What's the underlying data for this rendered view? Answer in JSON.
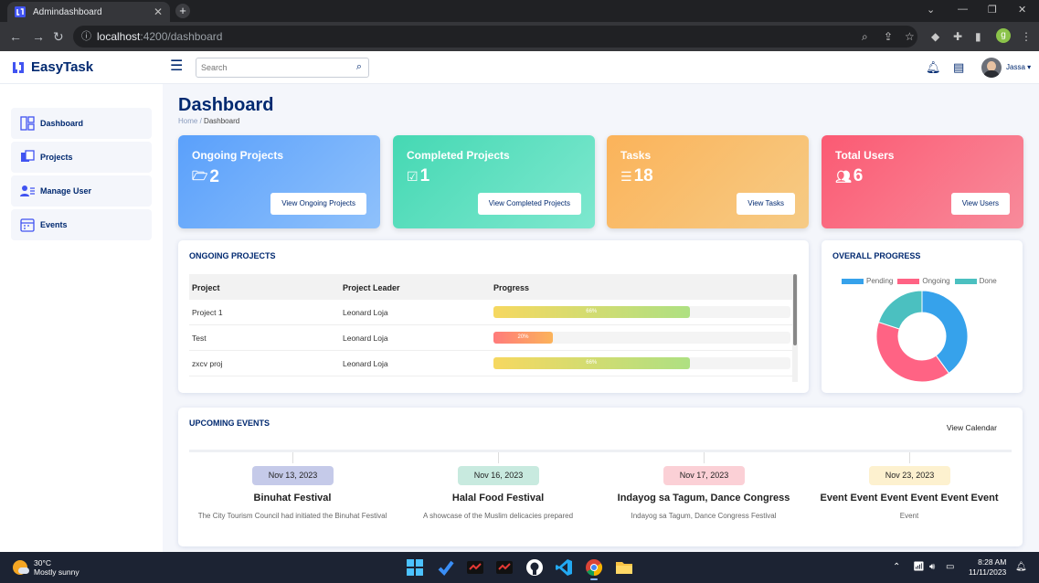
{
  "browser": {
    "tab_title": "Admindashboard",
    "url_host": "localhost",
    "url_path": ":4200/dashboard",
    "profile_initial": "g"
  },
  "header": {
    "logo_text": "EasyTask",
    "search_placeholder": "Search",
    "user_name": "Jassa"
  },
  "sidebar": {
    "items": [
      {
        "label": "Dashboard",
        "icon": "dashboard-icon"
      },
      {
        "label": "Projects",
        "icon": "projects-icon"
      },
      {
        "label": "Manage User",
        "icon": "manage-user-icon"
      },
      {
        "label": "Events",
        "icon": "events-icon"
      }
    ]
  },
  "page": {
    "title": "Dashboard",
    "breadcrumb_home": "Home",
    "breadcrumb_sep": "/",
    "breadcrumb_current": "Dashboard"
  },
  "stats": [
    {
      "title": "Ongoing Projects",
      "value": "2",
      "button": "View Ongoing Projects",
      "icon": "folder-open-icon"
    },
    {
      "title": "Completed Projects",
      "value": "1",
      "button": "View Completed Projects",
      "icon": "check-square-icon"
    },
    {
      "title": "Tasks",
      "value": "18",
      "button": "View Tasks",
      "icon": "list-icon"
    },
    {
      "title": "Total Users",
      "value": "6",
      "button": "View Users",
      "icon": "users-icon"
    }
  ],
  "ongoing": {
    "title": "ONGOING PROJECTS",
    "columns": [
      "Project",
      "Project Leader",
      "Progress"
    ],
    "rows": [
      {
        "project": "Project 1",
        "leader": "Leonard Loja",
        "progress": 66,
        "progress_label": "66%"
      },
      {
        "project": "Test",
        "leader": "Leonard Loja",
        "progress": 20,
        "progress_label": "20%"
      },
      {
        "project": "zxcv proj",
        "leader": "Leonard Loja",
        "progress": 66,
        "progress_label": "66%"
      }
    ]
  },
  "overall": {
    "title": "OVERALL PROGRESS",
    "chart_data": {
      "type": "pie",
      "categories": [
        "Pending",
        "Ongoing",
        "Done"
      ],
      "values": [
        2,
        2,
        1
      ],
      "colors": [
        "#36a2eb",
        "#ff6384",
        "#4bc0c0"
      ],
      "legend": "top"
    }
  },
  "events": {
    "title": "UPCOMING EVENTS",
    "view_calendar": "View Calendar",
    "items": [
      {
        "date": "Nov 13, 2023",
        "title": "Binuhat Festival",
        "desc": "The City Tourism Council had initiated the Binuhat Festival",
        "color": "#c5cae9"
      },
      {
        "date": "Nov 16, 2023",
        "title": "Halal Food Festival",
        "desc": "A showcase of the Muslim delicacies prepared",
        "color": "#c8eadf"
      },
      {
        "date": "Nov 17, 2023",
        "title": "Indayog sa Tagum, Dance Congress",
        "desc": "Indayog sa Tagum, Dance Congress Festival",
        "color": "#fbd0d6"
      },
      {
        "date": "Nov 23, 2023",
        "title": "Event Event Event Event Event Event",
        "desc": "Event",
        "color": "#fdf1cf"
      }
    ]
  },
  "taskbar": {
    "temp": "30°C",
    "weather": "Mostly sunny",
    "time": "8:28 AM",
    "date": "11/11/2023"
  }
}
